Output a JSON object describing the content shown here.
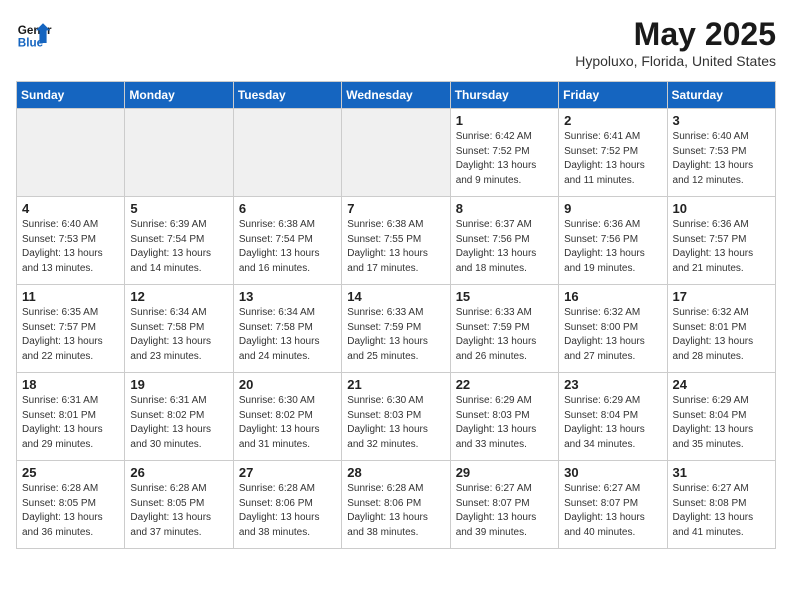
{
  "header": {
    "logo_line1": "General",
    "logo_line2": "Blue",
    "title": "May 2025",
    "subtitle": "Hypoluxo, Florida, United States"
  },
  "weekdays": [
    "Sunday",
    "Monday",
    "Tuesday",
    "Wednesday",
    "Thursday",
    "Friday",
    "Saturday"
  ],
  "weeks": [
    [
      {
        "day": "",
        "info": ""
      },
      {
        "day": "",
        "info": ""
      },
      {
        "day": "",
        "info": ""
      },
      {
        "day": "",
        "info": ""
      },
      {
        "day": "1",
        "info": "Sunrise: 6:42 AM\nSunset: 7:52 PM\nDaylight: 13 hours\nand 9 minutes."
      },
      {
        "day": "2",
        "info": "Sunrise: 6:41 AM\nSunset: 7:52 PM\nDaylight: 13 hours\nand 11 minutes."
      },
      {
        "day": "3",
        "info": "Sunrise: 6:40 AM\nSunset: 7:53 PM\nDaylight: 13 hours\nand 12 minutes."
      }
    ],
    [
      {
        "day": "4",
        "info": "Sunrise: 6:40 AM\nSunset: 7:53 PM\nDaylight: 13 hours\nand 13 minutes."
      },
      {
        "day": "5",
        "info": "Sunrise: 6:39 AM\nSunset: 7:54 PM\nDaylight: 13 hours\nand 14 minutes."
      },
      {
        "day": "6",
        "info": "Sunrise: 6:38 AM\nSunset: 7:54 PM\nDaylight: 13 hours\nand 16 minutes."
      },
      {
        "day": "7",
        "info": "Sunrise: 6:38 AM\nSunset: 7:55 PM\nDaylight: 13 hours\nand 17 minutes."
      },
      {
        "day": "8",
        "info": "Sunrise: 6:37 AM\nSunset: 7:56 PM\nDaylight: 13 hours\nand 18 minutes."
      },
      {
        "day": "9",
        "info": "Sunrise: 6:36 AM\nSunset: 7:56 PM\nDaylight: 13 hours\nand 19 minutes."
      },
      {
        "day": "10",
        "info": "Sunrise: 6:36 AM\nSunset: 7:57 PM\nDaylight: 13 hours\nand 21 minutes."
      }
    ],
    [
      {
        "day": "11",
        "info": "Sunrise: 6:35 AM\nSunset: 7:57 PM\nDaylight: 13 hours\nand 22 minutes."
      },
      {
        "day": "12",
        "info": "Sunrise: 6:34 AM\nSunset: 7:58 PM\nDaylight: 13 hours\nand 23 minutes."
      },
      {
        "day": "13",
        "info": "Sunrise: 6:34 AM\nSunset: 7:58 PM\nDaylight: 13 hours\nand 24 minutes."
      },
      {
        "day": "14",
        "info": "Sunrise: 6:33 AM\nSunset: 7:59 PM\nDaylight: 13 hours\nand 25 minutes."
      },
      {
        "day": "15",
        "info": "Sunrise: 6:33 AM\nSunset: 7:59 PM\nDaylight: 13 hours\nand 26 minutes."
      },
      {
        "day": "16",
        "info": "Sunrise: 6:32 AM\nSunset: 8:00 PM\nDaylight: 13 hours\nand 27 minutes."
      },
      {
        "day": "17",
        "info": "Sunrise: 6:32 AM\nSunset: 8:01 PM\nDaylight: 13 hours\nand 28 minutes."
      }
    ],
    [
      {
        "day": "18",
        "info": "Sunrise: 6:31 AM\nSunset: 8:01 PM\nDaylight: 13 hours\nand 29 minutes."
      },
      {
        "day": "19",
        "info": "Sunrise: 6:31 AM\nSunset: 8:02 PM\nDaylight: 13 hours\nand 30 minutes."
      },
      {
        "day": "20",
        "info": "Sunrise: 6:30 AM\nSunset: 8:02 PM\nDaylight: 13 hours\nand 31 minutes."
      },
      {
        "day": "21",
        "info": "Sunrise: 6:30 AM\nSunset: 8:03 PM\nDaylight: 13 hours\nand 32 minutes."
      },
      {
        "day": "22",
        "info": "Sunrise: 6:29 AM\nSunset: 8:03 PM\nDaylight: 13 hours\nand 33 minutes."
      },
      {
        "day": "23",
        "info": "Sunrise: 6:29 AM\nSunset: 8:04 PM\nDaylight: 13 hours\nand 34 minutes."
      },
      {
        "day": "24",
        "info": "Sunrise: 6:29 AM\nSunset: 8:04 PM\nDaylight: 13 hours\nand 35 minutes."
      }
    ],
    [
      {
        "day": "25",
        "info": "Sunrise: 6:28 AM\nSunset: 8:05 PM\nDaylight: 13 hours\nand 36 minutes."
      },
      {
        "day": "26",
        "info": "Sunrise: 6:28 AM\nSunset: 8:05 PM\nDaylight: 13 hours\nand 37 minutes."
      },
      {
        "day": "27",
        "info": "Sunrise: 6:28 AM\nSunset: 8:06 PM\nDaylight: 13 hours\nand 38 minutes."
      },
      {
        "day": "28",
        "info": "Sunrise: 6:28 AM\nSunset: 8:06 PM\nDaylight: 13 hours\nand 38 minutes."
      },
      {
        "day": "29",
        "info": "Sunrise: 6:27 AM\nSunset: 8:07 PM\nDaylight: 13 hours\nand 39 minutes."
      },
      {
        "day": "30",
        "info": "Sunrise: 6:27 AM\nSunset: 8:07 PM\nDaylight: 13 hours\nand 40 minutes."
      },
      {
        "day": "31",
        "info": "Sunrise: 6:27 AM\nSunset: 8:08 PM\nDaylight: 13 hours\nand 41 minutes."
      }
    ]
  ]
}
